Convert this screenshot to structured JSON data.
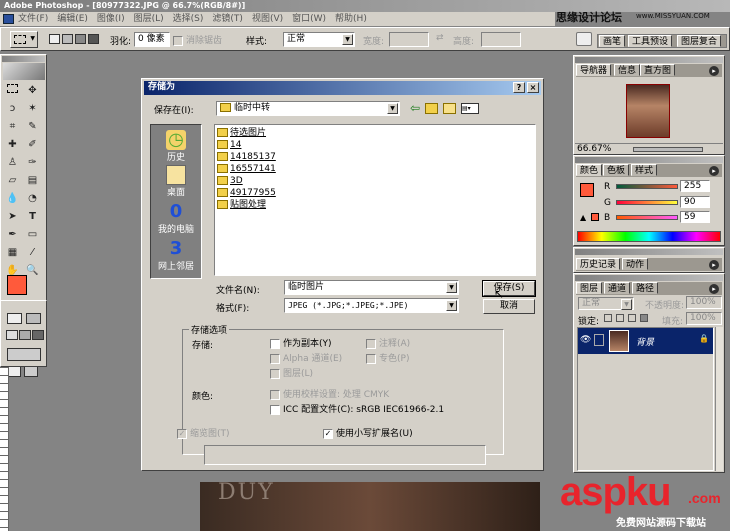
{
  "app": {
    "title": "Adobe Photoshop - [80977322.JPG @ 66.7%(RGB/8#)]",
    "watermark_top": "思缘设计论坛",
    "watermark_url": "www.MISSYUAN.COM",
    "aspku_logo": "aspku",
    "aspku_dotcom": ".com",
    "aspku_tagline": "免费网站源码下载站"
  },
  "menu": [
    "文件(F)",
    "编辑(E)",
    "图像(I)",
    "图层(L)",
    "选择(S)",
    "滤镜(T)",
    "视图(V)",
    "窗口(W)",
    "帮助(H)"
  ],
  "options_bar": {
    "feather_label": "羽化:",
    "feather_value": "0 像素",
    "antialias_label": "消除锯齿",
    "style_label": "样式:",
    "style_value": "正常",
    "width_label": "宽度:",
    "height_label": "高度:",
    "tabs": [
      "画笔",
      "工具预设",
      "图层复合"
    ]
  },
  "dialog": {
    "title": "存储为",
    "save_in_label": "保存在(I):",
    "save_in_value": "临时中转",
    "places": [
      "历史",
      "桌面",
      "我的电脑",
      "网上邻居"
    ],
    "files": [
      "待选图片",
      "14",
      "14185137",
      "16557141",
      "3D",
      "49177955",
      "贴图处理"
    ],
    "filename_label": "文件名(N):",
    "filename_value": "临时图片",
    "format_label": "格式(F):",
    "format_value": "JPEG (*.JPG;*.JPEG;*.JPE)",
    "save_button": "保存(S)",
    "cancel_button": "取消",
    "save_options_group": "存储选项",
    "store_label": "存储:",
    "opt_as_copy": "作为副本(Y)",
    "opt_annotations": "注释(A)",
    "opt_alpha": "Alpha 通道(E)",
    "opt_spot": "专色(P)",
    "opt_layers": "图层(L)",
    "color_label": "颜色:",
    "opt_proof": "使用校样设置: 处理 CMYK",
    "opt_icc": "ICC 配置文件(C): sRGB IEC61966-2.1",
    "opt_thumbnail": "缩览图(T)",
    "opt_lowercase": "使用小写扩展名(U)"
  },
  "navigator": {
    "tabs": [
      "导航器",
      "信息",
      "直方图"
    ],
    "zoom": "66.67%"
  },
  "color_panel": {
    "tabs": [
      "颜色",
      "色板",
      "样式"
    ],
    "channels": [
      {
        "label": "R",
        "value": "255"
      },
      {
        "label": "G",
        "value": "90"
      },
      {
        "label": "B",
        "value": "59"
      }
    ],
    "foreground": "#ff5a3b"
  },
  "history_panel": {
    "tabs": [
      "历史记录",
      "动作"
    ]
  },
  "layers_panel": {
    "tabs": [
      "图层",
      "通道",
      "路径"
    ],
    "blend_mode": "正常",
    "opacity_label": "不透明度:",
    "opacity_value": "100%",
    "lock_label": "锁定:",
    "fill_label": "填充:",
    "fill_value": "100%",
    "layer_name": "背景"
  },
  "canvas_text": "DUY"
}
